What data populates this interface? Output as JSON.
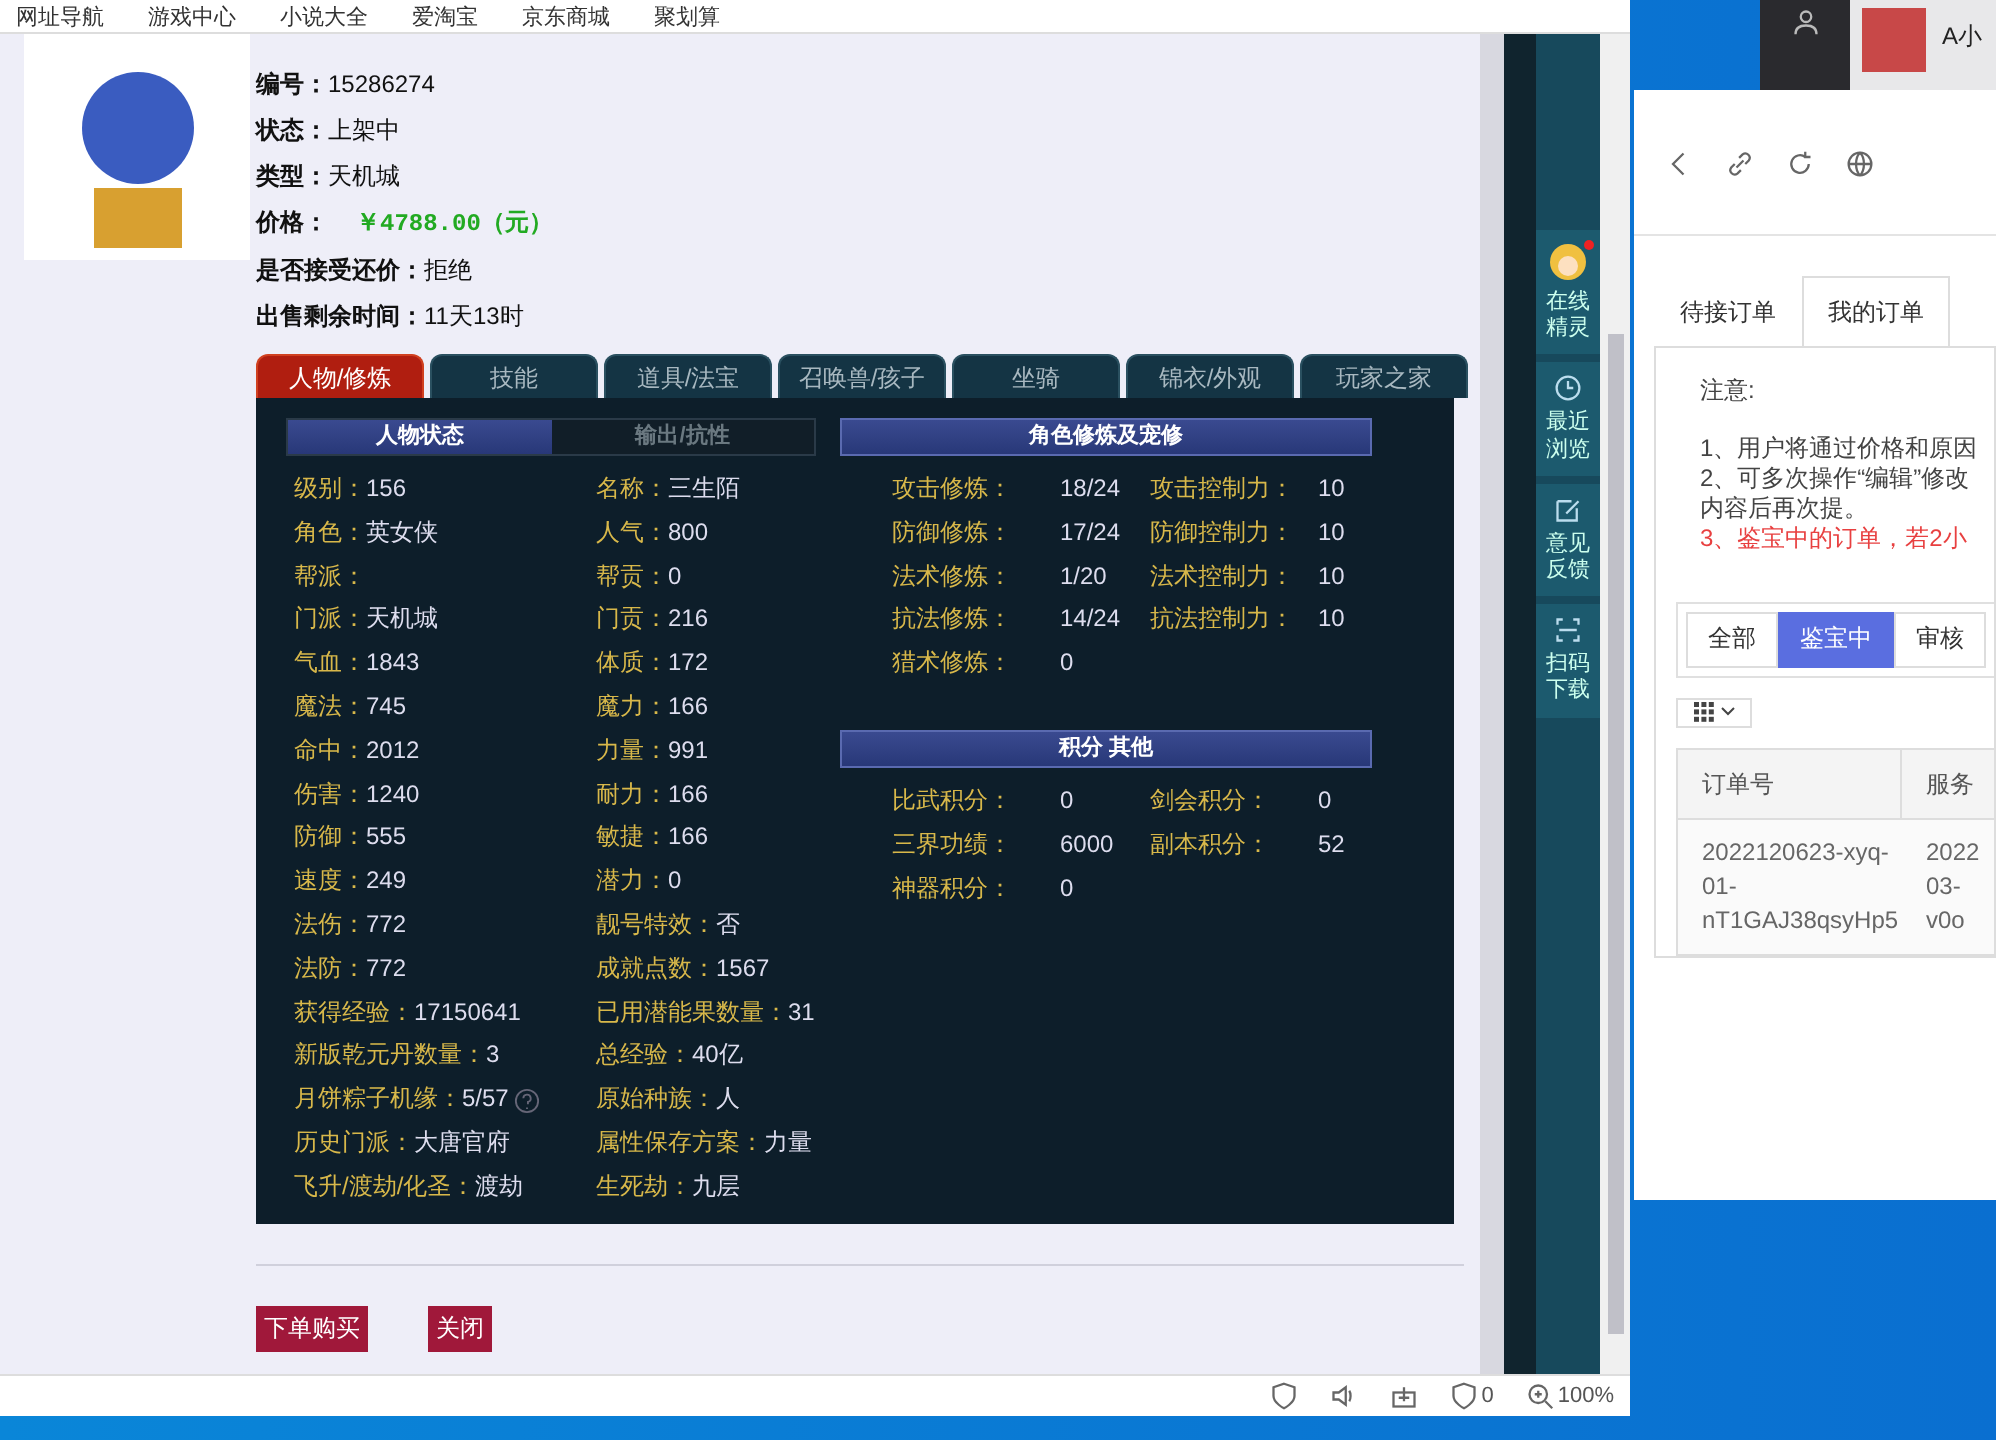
{
  "bookmarks": [
    {
      "label": "网址导航"
    },
    {
      "label": "游戏中心"
    },
    {
      "label": "小说大全"
    },
    {
      "label": "爱淘宝"
    },
    {
      "label": "京东商城"
    },
    {
      "label": "聚划算"
    }
  ],
  "listing": {
    "fields": [
      {
        "label": "编号：",
        "value": "15286274",
        "kind": "plain"
      },
      {
        "label": "状态：",
        "value": "上架中",
        "kind": "plain"
      },
      {
        "label": "类型：",
        "value": "天机城",
        "kind": "plain"
      },
      {
        "label": "价格：",
        "value": "￥4788.00（元）",
        "kind": "price"
      },
      {
        "label": "是否接受还价：",
        "value": "拒绝",
        "kind": "plain"
      },
      {
        "label": "出售剩余时间：",
        "value": "11天13时",
        "kind": "plain"
      }
    ]
  },
  "tabs": [
    {
      "label": "人物/修炼",
      "selected": true
    },
    {
      "label": "技能",
      "selected": false
    },
    {
      "label": "道具/法宝",
      "selected": false
    },
    {
      "label": "召唤兽/孩子",
      "selected": false
    },
    {
      "label": "坐骑",
      "selected": false
    },
    {
      "label": "锦衣/外观",
      "selected": false
    },
    {
      "label": "玩家之家",
      "selected": false
    }
  ],
  "stat_tabs": [
    {
      "label": "人物状态",
      "selected": true
    },
    {
      "label": "输出/抗性",
      "selected": false
    }
  ],
  "stats_left": [
    {
      "label": "级别：",
      "value": "156"
    },
    {
      "label": "角色：",
      "value": "英女侠"
    },
    {
      "label": "帮派："
    },
    {
      "label": "门派：",
      "value": "天机城"
    },
    {
      "label": "气血：",
      "value": "1843"
    },
    {
      "label": "魔法：",
      "value": "745"
    },
    {
      "label": "命中：",
      "value": "2012"
    },
    {
      "label": "伤害：",
      "value": "1240"
    },
    {
      "label": "防御：",
      "value": "555"
    },
    {
      "label": "速度：",
      "value": "249"
    },
    {
      "label": "法伤：",
      "value": "772"
    },
    {
      "label": "法防：",
      "value": "772"
    },
    {
      "label": "获得经验：",
      "value": "17150641"
    },
    {
      "label": "新版乾元丹数量：",
      "value": "3"
    },
    {
      "label": "月饼粽子机缘：",
      "value": "5/57",
      "help": true
    },
    {
      "label": "历史门派：",
      "value": "大唐官府"
    },
    {
      "label": "飞升/渡劫/化圣：",
      "value": "渡劫"
    }
  ],
  "stats_right": [
    {
      "label": "名称：",
      "value": "三生陌"
    },
    {
      "label": "人气：",
      "value": "800"
    },
    {
      "label": "帮贡：",
      "value": "0"
    },
    {
      "label": "门贡：",
      "value": "216"
    },
    {
      "label": "体质：",
      "value": "172"
    },
    {
      "label": "魔力：",
      "value": "166"
    },
    {
      "label": "力量：",
      "value": "991"
    },
    {
      "label": "耐力：",
      "value": "166"
    },
    {
      "label": "敏捷：",
      "value": "166"
    },
    {
      "label": "潜力：",
      "value": "0"
    },
    {
      "label": "靓号特效：",
      "value": "否"
    },
    {
      "label": "成就点数：",
      "value": "1567"
    },
    {
      "label": "已用潜能果数量：",
      "value": "31"
    },
    {
      "label": "总经验：",
      "value": "40亿"
    },
    {
      "label": "原始种族：",
      "value": "人"
    },
    {
      "label": "属性保存方案：",
      "value": "力量"
    },
    {
      "label": "生死劫：",
      "value": "九层"
    }
  ],
  "cultivation": {
    "title": "角色修炼及宠修",
    "rows": [
      {
        "label": "攻击修炼：",
        "value": "18/24",
        "control_label": "攻击控制力：",
        "control_value": "10"
      },
      {
        "label": "防御修炼：",
        "value": "17/24",
        "control_label": "防御控制力：",
        "control_value": "10"
      },
      {
        "label": "法术修炼：",
        "value": "1/20",
        "control_label": "法术控制力：",
        "control_value": "10"
      },
      {
        "label": "抗法修炼：",
        "value": "14/24",
        "control_label": "抗法控制力：",
        "control_value": "10"
      },
      {
        "label": "猎术修炼：",
        "value": "0"
      }
    ]
  },
  "scores": {
    "title": "积分 其他",
    "rows": [
      {
        "label": "比武积分：",
        "value": "0",
        "label_2": "剑会积分：",
        "value_2": "0"
      },
      {
        "label": "三界功绩：",
        "value": "6000",
        "label_2": "副本积分：",
        "value_2": "52"
      },
      {
        "label": "神器积分：",
        "value": "0"
      }
    ]
  },
  "actions": [
    {
      "label": "下单购买"
    },
    {
      "label": "关闭"
    }
  ],
  "dock": [
    {
      "label": "在线精灵",
      "kind": "avatar"
    },
    {
      "label": "最近浏览",
      "kind": "clock"
    },
    {
      "label": "意见反馈",
      "kind": "edit"
    },
    {
      "label": "扫码下载",
      "kind": "scan"
    }
  ],
  "status_bar": {
    "blocked_count": "0",
    "zoom": "100%"
  },
  "chat_contact": {
    "name": "A小"
  },
  "order_window": {
    "tabs": [
      {
        "label": "待接订单",
        "selected": false
      },
      {
        "label": "我的订单",
        "selected": true
      }
    ],
    "note_title": "注意:",
    "notes": [
      {
        "text": "1、用户将通过价格和原因",
        "kind": "normal"
      },
      {
        "text": "2、可多次操作“编辑”修改",
        "kind": "normal"
      },
      {
        "text": "内容后再次提。",
        "kind": "normal"
      },
      {
        "text": "3、鉴宝中的订单，若2小",
        "kind": "warning"
      }
    ],
    "filters": [
      {
        "label": "全部",
        "selected": false
      },
      {
        "label": "鉴宝中",
        "selected": true
      },
      {
        "label": "审核",
        "selected": false
      }
    ],
    "table": {
      "columns": [
        "订单号",
        "服务"
      ],
      "rows": [
        [
          [
            "2022120623-xyq-",
            "01-",
            "nT1GAJ38qsyHp5"
          ],
          [
            "2022",
            "03-",
            "v0o"
          ]
        ]
      ]
    }
  }
}
